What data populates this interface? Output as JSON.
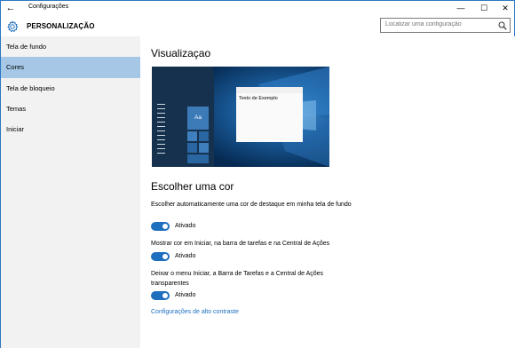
{
  "window": {
    "title": "Configurações",
    "back_glyph": "←",
    "controls": {
      "minimize": "—",
      "maximize": "☐",
      "close": "✕"
    }
  },
  "header": {
    "icon": "gear-icon",
    "title": "PERSONALIZAÇÃO",
    "search_placeholder": "Localizar uma configuração",
    "search_icon": "search-icon"
  },
  "sidebar": {
    "items": [
      {
        "label": "Tela de fundo",
        "selected": false
      },
      {
        "label": "Cores",
        "selected": true
      },
      {
        "label": "Tela de bloqueio",
        "selected": false
      },
      {
        "label": "Temas",
        "selected": false
      },
      {
        "label": "Iniciar",
        "selected": false
      }
    ]
  },
  "main": {
    "preview_heading": "Visualizaçao",
    "preview": {
      "tile_label": "Aa",
      "sample_window_text": "Texto de Exemplo"
    },
    "color_heading": "Escolher uma cor",
    "options": [
      {
        "label": "Escolher automaticamente uma cor de destaque em minha tela de fundo",
        "toggle_on": true,
        "state": "Ativado"
      },
      {
        "label": "Mostrar cor em Iniciar, na barra de tarefas e na Central de Ações",
        "toggle_on": true,
        "state": "Ativado"
      },
      {
        "label": "Deixar o menu Iniciar, a Barra de Tarefas e a Central de Ações transparentes",
        "toggle_on": true,
        "state": "Ativado"
      }
    ],
    "high_contrast_link": "Configurações de alto contraste"
  },
  "colors": {
    "accent": "#1f6fbf",
    "selected_item": "#a6c8e6",
    "link": "#1a6fc0",
    "sidebar_bg": "#f2f2f2"
  }
}
